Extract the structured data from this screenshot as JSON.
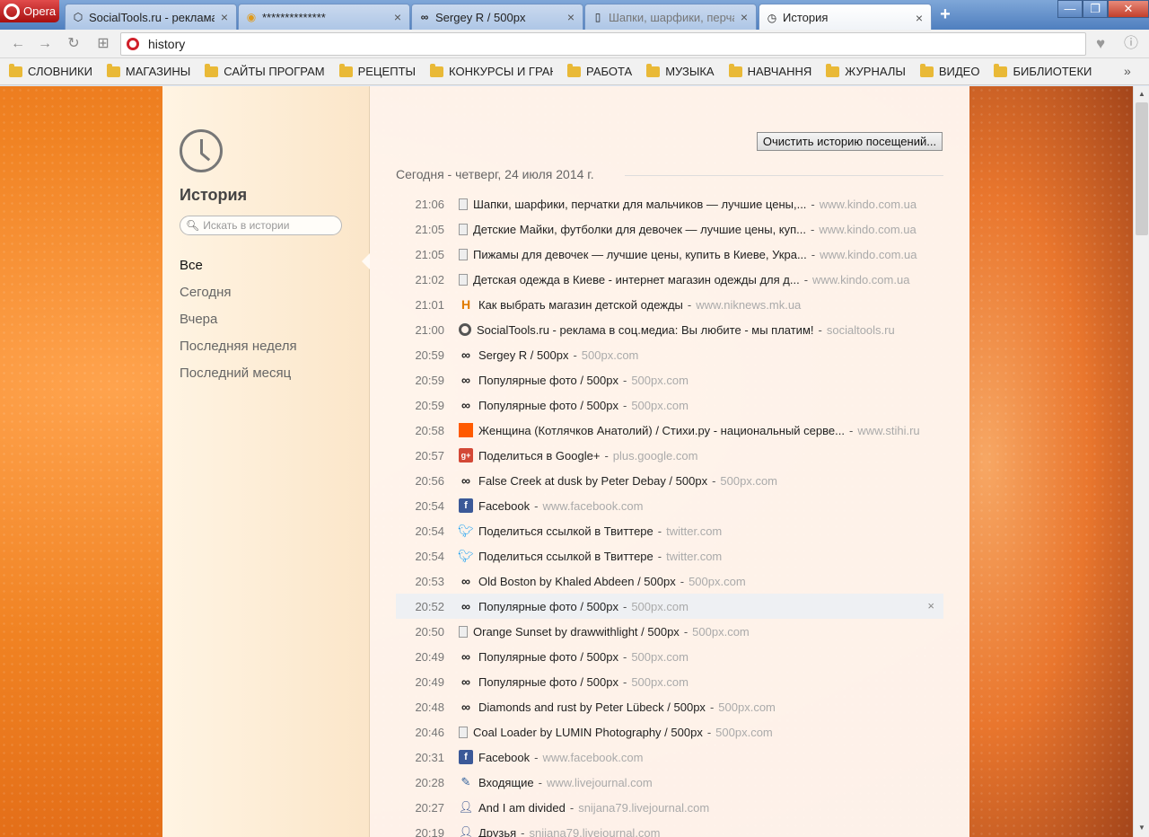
{
  "browser": {
    "menu_label": "Opera",
    "tabs": [
      {
        "title": "SocialTools.ru - реклама в соц.медиа",
        "active": false
      },
      {
        "title": "**************",
        "active": false
      },
      {
        "title": "Sergey R / 500px",
        "active": false
      },
      {
        "title": "Шапки, шарфики, перчатки",
        "active": false
      },
      {
        "title": "История",
        "active": true
      }
    ],
    "new_tab": "+",
    "address": "history",
    "bookmarks": [
      "СЛОВНИКИ",
      "МАГАЗИНЫ",
      "САЙТЫ ПРОГРАМ",
      "РЕЦЕПТЫ",
      "КОНКУРСЫ И ГРАНТ",
      "РАБОТА",
      "МУЗЫКА",
      "НАВЧАННЯ",
      "ЖУРНАЛЫ",
      "ВИДЕО",
      "БИБЛИОТЕКИ"
    ],
    "bookmarks_more": "»"
  },
  "sidebar": {
    "title": "История",
    "search_placeholder": "Искать в истории",
    "filters": [
      "Все",
      "Сегодня",
      "Вчера",
      "Последняя неделя",
      "Последний месяц"
    ],
    "active_filter": "Все"
  },
  "main": {
    "clear_button": "Очистить историю посещений...",
    "date_heading": "Сегодня - четверг, 24 июля 2014 г.",
    "separator": "-",
    "entries": [
      {
        "time": "21:06",
        "icon": "doc",
        "title": "Шапки, шарфики, перчатки для мальчиков — лучшие цены,...",
        "domain": "www.kindo.com.ua"
      },
      {
        "time": "21:05",
        "icon": "doc",
        "title": "Детские Майки, футболки для девочек — лучшие цены, куп...",
        "domain": "www.kindo.com.ua"
      },
      {
        "time": "21:05",
        "icon": "doc",
        "title": "Пижамы для девочек — лучшие цены, купить в Киеве, Укра...",
        "domain": "www.kindo.com.ua"
      },
      {
        "time": "21:02",
        "icon": "doc",
        "title": "Детская одежда в Киеве - интернет магазин одежды для д...",
        "domain": "www.kindo.com.ua"
      },
      {
        "time": "21:01",
        "icon": "niknews",
        "title": "Как выбрать магазин детской одежды",
        "domain": "www.niknews.mk.ua"
      },
      {
        "time": "21:00",
        "icon": "socialtools",
        "title": "SocialTools.ru - реклама в соц.медиа: Вы любите - мы платим!",
        "domain": "socialtools.ru"
      },
      {
        "time": "20:59",
        "icon": "500px",
        "title": "Sergey R / 500px",
        "domain": "500px.com"
      },
      {
        "time": "20:59",
        "icon": "500px",
        "title": "Популярные фото / 500px",
        "domain": "500px.com"
      },
      {
        "time": "20:59",
        "icon": "500px",
        "title": "Популярные фото / 500px",
        "domain": "500px.com"
      },
      {
        "time": "20:58",
        "icon": "stihi",
        "title": "Женщина (Котлячков Анатолий) / Стихи.ру - национальный серве...",
        "domain": "www.stihi.ru"
      },
      {
        "time": "20:57",
        "icon": "gplus",
        "title": "Поделиться в Google+",
        "domain": "plus.google.com"
      },
      {
        "time": "20:56",
        "icon": "500px",
        "title": "False Creek at dusk by Peter Debay / 500px",
        "domain": "500px.com"
      },
      {
        "time": "20:54",
        "icon": "facebook",
        "title": "Facebook",
        "domain": "www.facebook.com"
      },
      {
        "time": "20:54",
        "icon": "twitter",
        "title": "Поделиться ссылкой в Твиттере",
        "domain": "twitter.com"
      },
      {
        "time": "20:54",
        "icon": "twitter",
        "title": "Поделиться ссылкой в Твиттере",
        "domain": "twitter.com"
      },
      {
        "time": "20:53",
        "icon": "500px",
        "title": "Old Boston by Khaled Abdeen / 500px",
        "domain": "500px.com"
      },
      {
        "time": "20:52",
        "icon": "500px",
        "title": "Популярные фото / 500px",
        "domain": "500px.com",
        "hover": true
      },
      {
        "time": "20:50",
        "icon": "doc",
        "title": "Orange Sunset by drawwithlight / 500px",
        "domain": "500px.com"
      },
      {
        "time": "20:49",
        "icon": "500px",
        "title": "Популярные фото / 500px",
        "domain": "500px.com"
      },
      {
        "time": "20:49",
        "icon": "500px",
        "title": "Популярные фото / 500px",
        "domain": "500px.com"
      },
      {
        "time": "20:48",
        "icon": "500px",
        "title": "Diamonds and rust by Peter Lübeck / 500px",
        "domain": "500px.com"
      },
      {
        "time": "20:46",
        "icon": "doc",
        "title": "Coal Loader by LUMIN Photography / 500px",
        "domain": "500px.com"
      },
      {
        "time": "20:31",
        "icon": "facebook",
        "title": "Facebook",
        "domain": "www.facebook.com"
      },
      {
        "time": "20:28",
        "icon": "livejournal",
        "title": "Входящие",
        "domain": "www.livejournal.com"
      },
      {
        "time": "20:27",
        "icon": "user",
        "title": "And I am divided",
        "domain": "snijana79.livejournal.com"
      },
      {
        "time": "20:19",
        "icon": "user",
        "title": "Друзья",
        "domain": "snijana79.livejournal.com"
      }
    ],
    "remove_glyph": "×"
  },
  "colors": {
    "accent_tab": "#5b86c4",
    "opera_red": "#c8161d",
    "domain_gray": "#aaaaaa"
  }
}
